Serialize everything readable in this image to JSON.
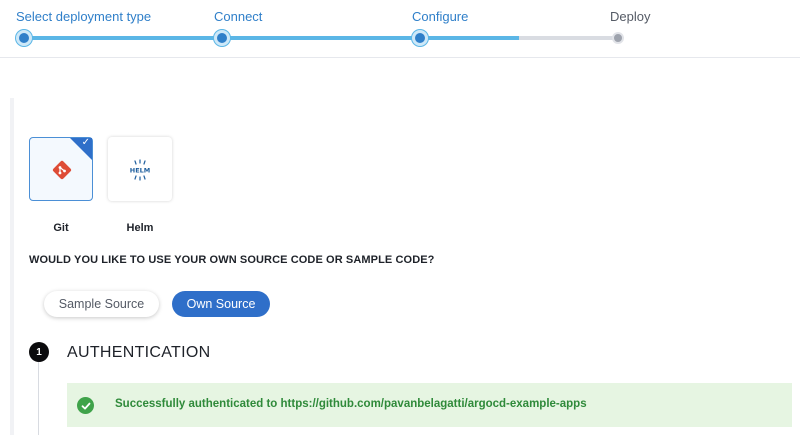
{
  "stepper": {
    "steps": [
      {
        "label": "Select deployment type",
        "state": "done"
      },
      {
        "label": "Connect",
        "state": "done"
      },
      {
        "label": "Configure",
        "state": "current"
      },
      {
        "label": "Deploy",
        "state": "todo"
      }
    ],
    "current_step_progress": 0.5
  },
  "deployment_types": [
    {
      "label": "Git",
      "icon": "git-icon",
      "selected": true
    },
    {
      "label": "Helm",
      "icon": "helm-icon",
      "selected": false,
      "icon_text": "HELM"
    }
  ],
  "source": {
    "question": "WOULD YOU LIKE TO USE YOUR OWN SOURCE CODE OR SAMPLE CODE?",
    "options": [
      {
        "label": "Sample Source",
        "selected": false
      },
      {
        "label": "Own Source",
        "selected": true
      }
    ]
  },
  "authentication": {
    "number": "1",
    "title": "AUTHENTICATION",
    "success_message": "Successfully authenticated to https://github.com/pavanbelagatti/argocd-example-apps"
  },
  "colors": {
    "accent": "#2f6fc9",
    "progress": "#5bb6e6",
    "success_bg": "#e6f5e2",
    "success_text": "#2f8a3a"
  }
}
